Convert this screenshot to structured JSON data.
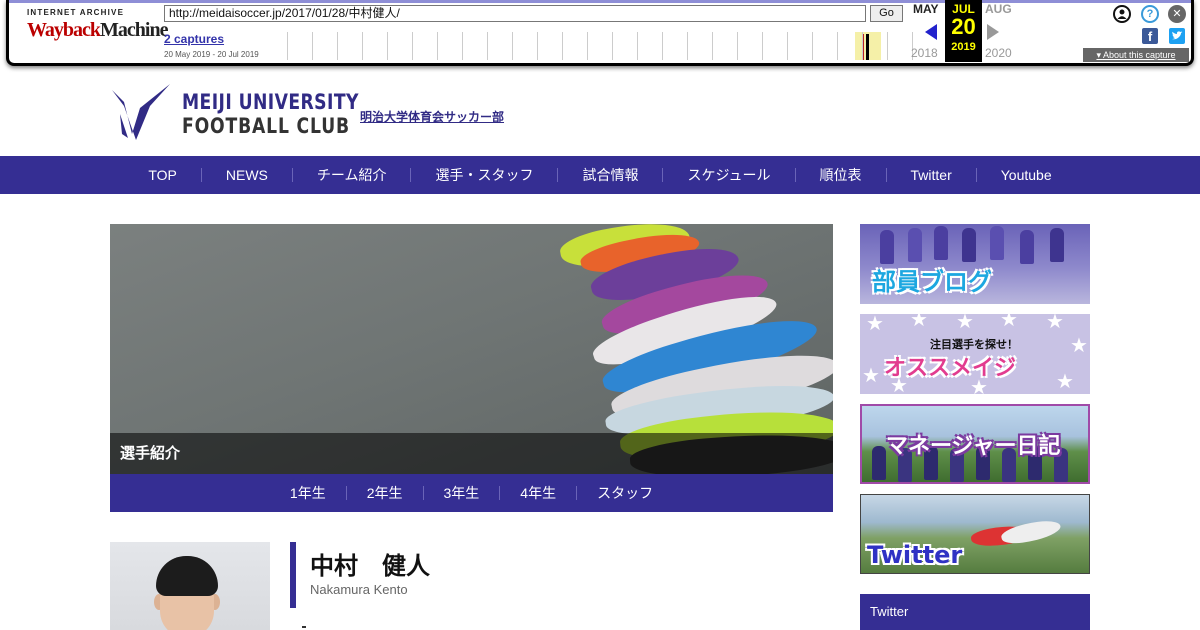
{
  "wayback": {
    "logo_top": "INTERNET ARCHIVE",
    "logo_wayback": "Wayback",
    "logo_machine": "Machine",
    "url": "http://meidaisoccer.jp/2017/01/28/中村健人/",
    "go_label": "Go",
    "captures": "2 captures",
    "range": "20 May 2019 - 20 Jul 2019",
    "prev_month": "MAY",
    "cur_month": "JUL",
    "next_month": "AUG",
    "cur_day": "20",
    "prev_year": "2018",
    "cur_year": "2019",
    "next_year": "2020",
    "about": "About this capture",
    "colors": {
      "accent": "#2222cc",
      "current": "#000000",
      "current_text": "#ffff00"
    }
  },
  "site": {
    "logo_line1": "MEIJI UNIVERSITY",
    "logo_line2": "FOOTBALL CLUB",
    "club_link": "明治大学体育会サッカー部",
    "brand_color": "#352e93"
  },
  "nav": {
    "items": [
      {
        "label": "TOP"
      },
      {
        "label": "NEWS"
      },
      {
        "label": "チーム紹介"
      },
      {
        "label": "選手・スタッフ"
      },
      {
        "label": "試合情報"
      },
      {
        "label": "スケジュール"
      },
      {
        "label": "順位表"
      },
      {
        "label": "Twitter"
      },
      {
        "label": "Youtube"
      }
    ]
  },
  "hero": {
    "caption": "選手紹介"
  },
  "subnav": {
    "items": [
      {
        "label": "1年生"
      },
      {
        "label": "2年生"
      },
      {
        "label": "3年生"
      },
      {
        "label": "4年生"
      },
      {
        "label": "スタッフ"
      }
    ]
  },
  "player": {
    "name_jp": "中村　健人",
    "name_en": "Nakamura Kento"
  },
  "sidebar": {
    "banners": [
      {
        "label": "部員ブログ"
      },
      {
        "sub": "注目選手を探せ！",
        "label": "オススメイジ"
      },
      {
        "label": "マネージャー日記"
      },
      {
        "label": "Twitter"
      }
    ],
    "section_title": "Twitter"
  }
}
